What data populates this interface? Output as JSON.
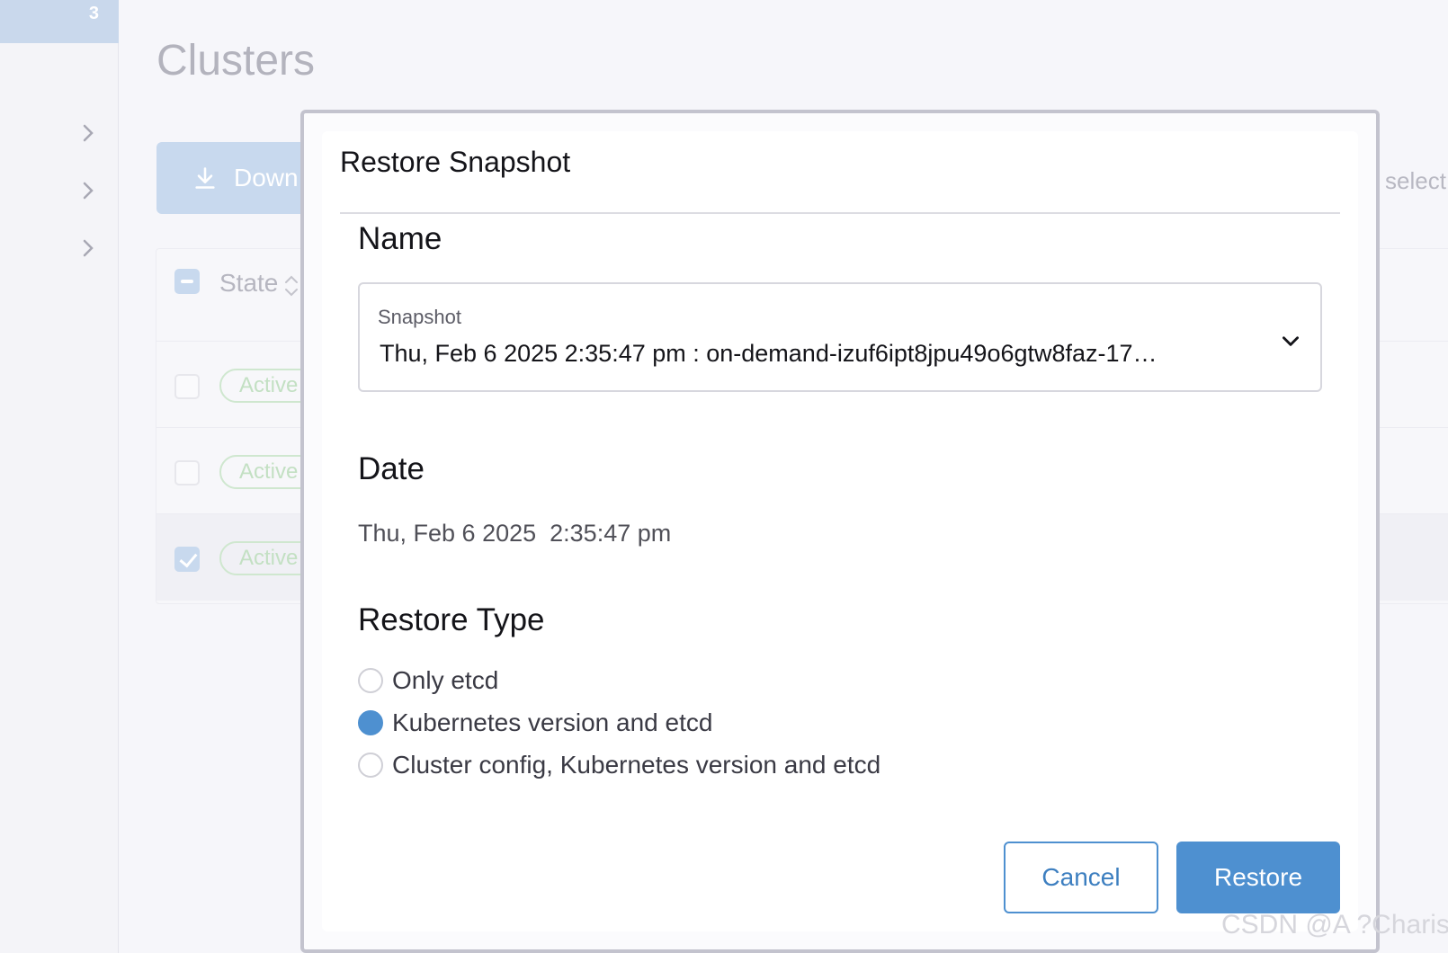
{
  "sidebar": {
    "badge": "3"
  },
  "page": {
    "title": "Clusters",
    "download_label": "Down",
    "select_hint": "select"
  },
  "table": {
    "header_state": "State",
    "rows": [
      {
        "state": "Active",
        "selected": false
      },
      {
        "state": "Active",
        "selected": false
      },
      {
        "state": "Active",
        "selected": true
      }
    ]
  },
  "modal": {
    "title": "Restore Snapshot",
    "name_heading": "Name",
    "snapshot_label": "Snapshot",
    "snapshot_value": "Thu, Feb 6 2025 2:35:47 pm : on-demand-izuf6ipt8jpu49o6gtw8faz-17…",
    "date_heading": "Date",
    "date_value": "Thu, Feb 6 2025  2:35:47 pm",
    "restore_type_heading": "Restore Type",
    "restore_options": [
      {
        "label": "Only etcd",
        "selected": false
      },
      {
        "label": "Kubernetes version and etcd",
        "selected": true
      },
      {
        "label": "Cluster config, Kubernetes version and etcd",
        "selected": false
      }
    ],
    "cancel_label": "Cancel",
    "restore_label": "Restore"
  },
  "watermark": "CSDN @A ?Charis",
  "colors": {
    "accent": "#4e90d0",
    "active_pill": "#cfe7cf"
  }
}
